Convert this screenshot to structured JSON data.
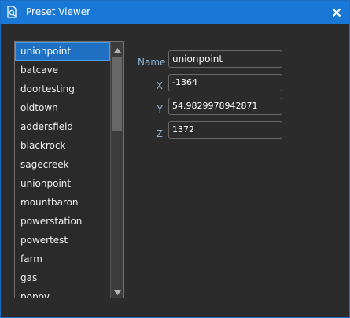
{
  "window": {
    "title": "Preset Viewer"
  },
  "presets": {
    "selected_index": 0,
    "items": [
      "unionpoint",
      "batcave",
      "doortesting",
      "oldtown",
      "addersfield",
      "blackrock",
      "sagecreek",
      "unionpoint",
      "mountbaron",
      "powerstation",
      "powertest",
      "farm",
      "gas",
      "popov"
    ]
  },
  "fields": {
    "name": {
      "label": "Name",
      "value": "unionpoint"
    },
    "x": {
      "label": "X",
      "value": "-1364"
    },
    "y": {
      "label": "Y",
      "value": "54.9829978942871"
    },
    "z": {
      "label": "Z",
      "value": "1372"
    }
  },
  "colors": {
    "titlebar": "#1978d6",
    "accent_selected": "#1f6fc2",
    "label": "#8fb3d6",
    "background": "#2b2b2b"
  },
  "icons": {
    "app": "document-icon",
    "close": "close-icon",
    "scroll_up": "arrow-up-icon",
    "scroll_down": "arrow-down-icon"
  }
}
